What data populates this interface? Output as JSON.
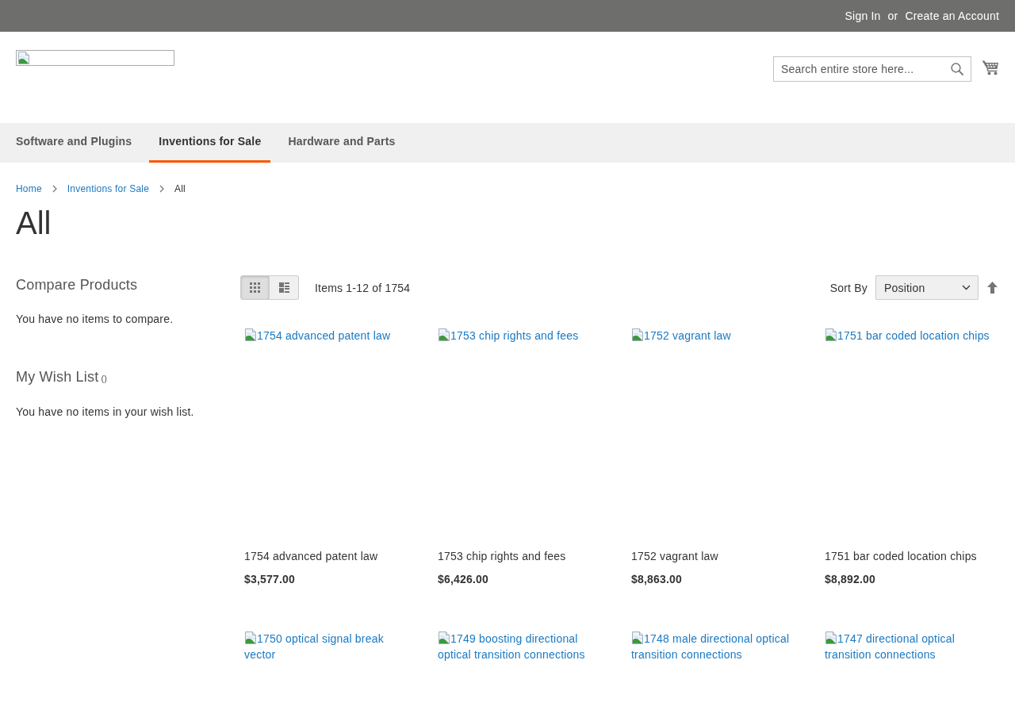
{
  "top_bar": {
    "links": [
      "Sign In",
      "Create an Account"
    ],
    "separator": "or"
  },
  "header": {
    "search": {
      "placeholder": "Search entire store here..."
    }
  },
  "nav": {
    "items": [
      {
        "label": "Software and Plugins",
        "selected": false
      },
      {
        "label": "Inventions for Sale",
        "selected": true
      },
      {
        "label": "Hardware and Parts",
        "selected": false
      }
    ]
  },
  "breadcrumbs": [
    {
      "kind": "link",
      "label": "Home"
    },
    {
      "kind": "link",
      "label": "Inventions for Sale"
    },
    {
      "kind": "current",
      "label": "All"
    }
  ],
  "page_title": "All",
  "sidebar": {
    "compare": {
      "title": "Compare Products",
      "empty_text": "You have no items to compare."
    },
    "wishlist": {
      "title": "My Wish List",
      "counter": "()",
      "empty_text": "You have no items in your wish list."
    }
  },
  "toolbar": {
    "view_modes": [
      {
        "kind": "grid",
        "selected": true
      },
      {
        "kind": "list",
        "selected": false
      }
    ],
    "amount": "Items 1-12 of 1754",
    "sort_label": "Sort By",
    "sort_value": "Position"
  },
  "products": [
    {
      "image_alt": "1754 advanced patent law",
      "name": "1754 advanced patent law",
      "price": "$3,577.00"
    },
    {
      "image_alt": "1753 chip rights and fees",
      "name": "1753 chip rights and fees",
      "price": "$6,426.00"
    },
    {
      "image_alt": "1752 vagrant law",
      "name": "1752 vagrant law",
      "price": "$8,863.00"
    },
    {
      "image_alt": "1751 bar coded location chips",
      "name": "1751 bar coded location chips",
      "price": "$8,892.00"
    },
    {
      "image_alt": "1750 optical signal break vector"
    },
    {
      "image_alt": "1749 boosting directional optical transition connections"
    },
    {
      "image_alt": "1748 male directional optical transition connections"
    },
    {
      "image_alt": "1747 directional optical transition connections"
    }
  ]
}
